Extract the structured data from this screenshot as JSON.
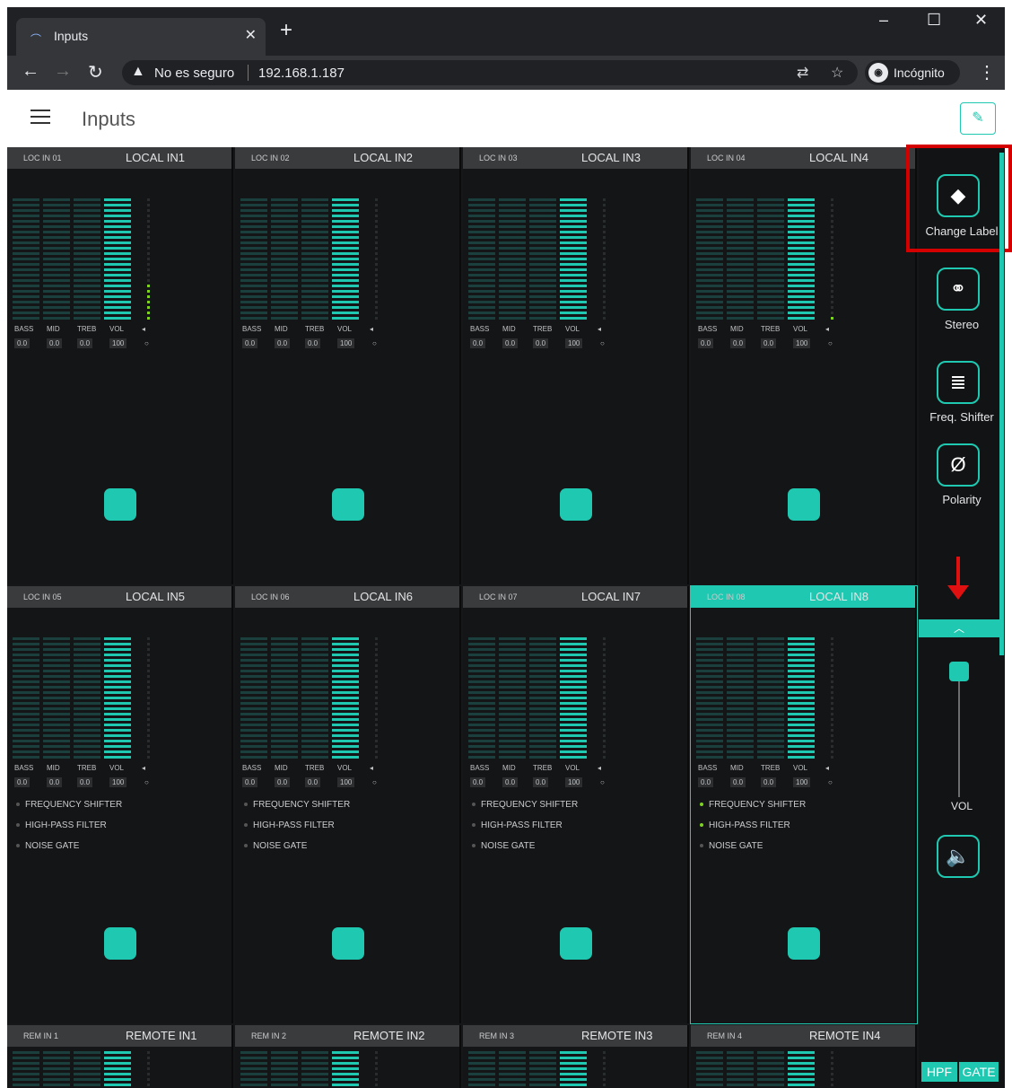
{
  "browser": {
    "tab_title": "Inputs",
    "new_tab": "+",
    "security_text": "No es seguro",
    "url": "192.168.1.187",
    "incognito_label": "Incógnito",
    "window_controls": [
      "–",
      "☐",
      "✕"
    ]
  },
  "app": {
    "title": "Inputs",
    "accent_color": "#1fc8b0"
  },
  "strip_labels": [
    "BASS",
    "MID",
    "TREB",
    "VOL"
  ],
  "channels": [
    {
      "id": "LOC IN 01",
      "name": "LOCAL IN1",
      "values": [
        "0.0",
        "0.0",
        "0.0",
        "100"
      ]
    },
    {
      "id": "LOC IN 02",
      "name": "LOCAL IN2",
      "values": [
        "0.0",
        "0.0",
        "0.0",
        "100"
      ]
    },
    {
      "id": "LOC IN 03",
      "name": "LOCAL IN3",
      "values": [
        "0.0",
        "0.0",
        "0.0",
        "100"
      ]
    },
    {
      "id": "LOC IN 04",
      "name": "LOCAL IN4",
      "values": [
        "0.0",
        "0.0",
        "0.0",
        "100"
      ]
    },
    {
      "id": "LOC IN 05",
      "name": "LOCAL IN5",
      "values": [
        "0.0",
        "0.0",
        "0.0",
        "100"
      ]
    },
    {
      "id": "LOC IN 06",
      "name": "LOCAL IN6",
      "values": [
        "0.0",
        "0.0",
        "0.0",
        "100"
      ]
    },
    {
      "id": "LOC IN 07",
      "name": "LOCAL IN7",
      "values": [
        "0.0",
        "0.0",
        "0.0",
        "100"
      ]
    },
    {
      "id": "LOC IN 08",
      "name": "LOCAL IN8",
      "values": [
        "0.0",
        "0.0",
        "0.0",
        "100"
      ],
      "selected": true
    },
    {
      "id": "REM IN 1",
      "name": "REMOTE IN1"
    },
    {
      "id": "REM IN 2",
      "name": "REMOTE IN2"
    },
    {
      "id": "REM IN 3",
      "name": "REMOTE IN3"
    },
    {
      "id": "REM IN 4",
      "name": "REMOTE IN4"
    }
  ],
  "effects": [
    "FREQUENCY SHIFTER",
    "HIGH-PASS FILTER",
    "NOISE GATE"
  ],
  "side_panel": {
    "buttons": [
      {
        "label": "Change Label",
        "icon": "tag-icon"
      },
      {
        "label": "Stereo",
        "icon": "link-icon"
      },
      {
        "label": "Freq. Shifter",
        "icon": "mic-icon"
      },
      {
        "label": "Polarity",
        "icon": "polarity-icon"
      }
    ],
    "vol_label": "VOL",
    "tags": [
      "HPF",
      "GATE"
    ]
  }
}
